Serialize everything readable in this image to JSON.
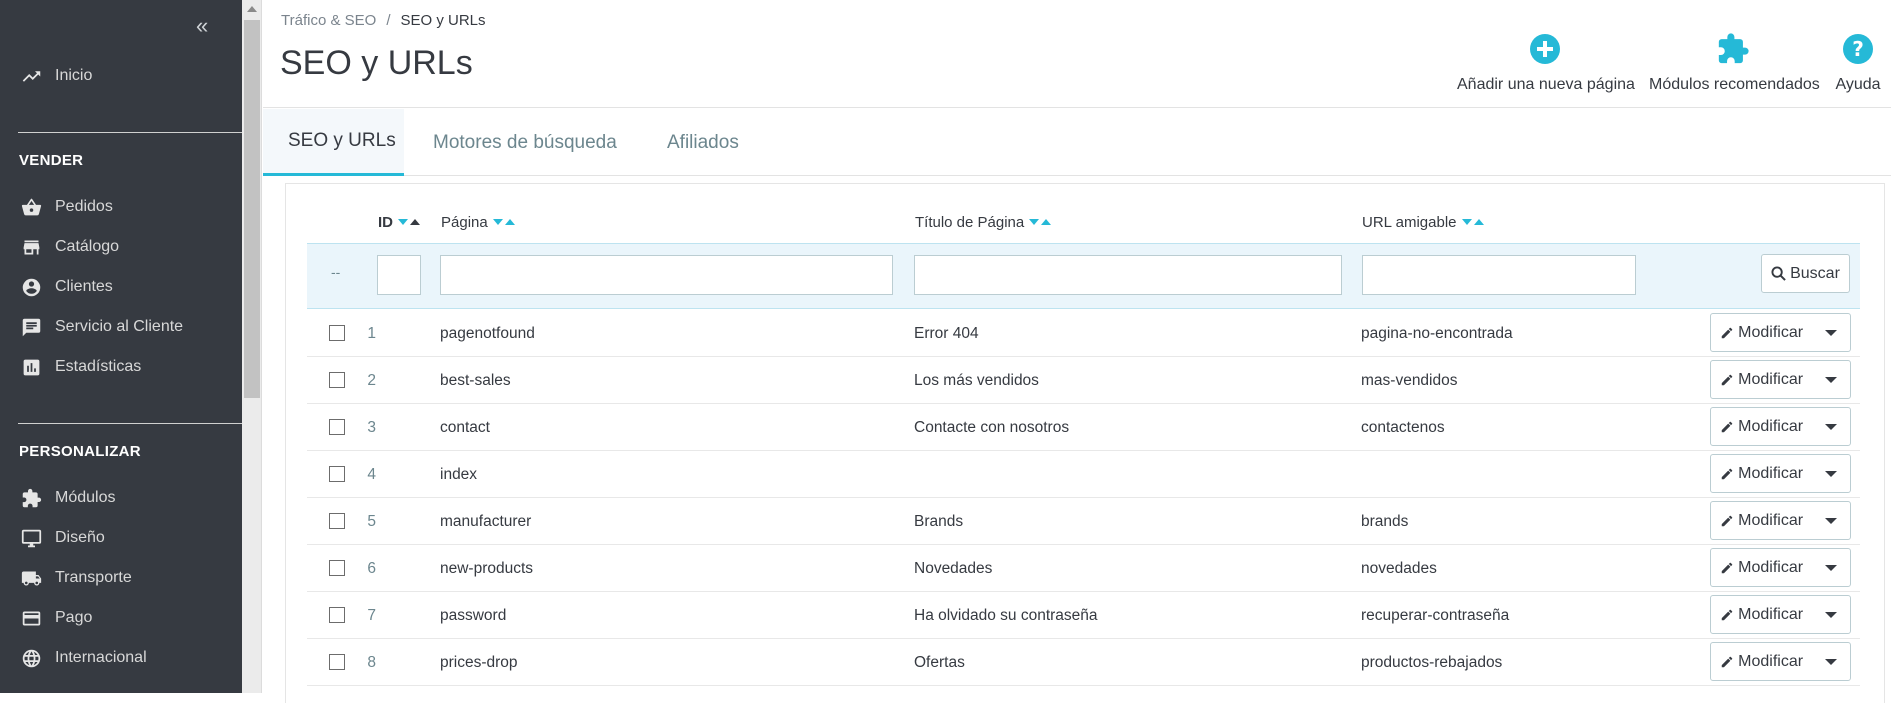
{
  "sidebar": {
    "collapse_glyph": "«",
    "items_top": [
      {
        "label": "Inicio",
        "icon": "trending-up-icon"
      }
    ],
    "section_sell": "VENDER",
    "items_sell": [
      {
        "label": "Pedidos",
        "icon": "basket-icon"
      },
      {
        "label": "Catálogo",
        "icon": "store-icon"
      },
      {
        "label": "Clientes",
        "icon": "account-circle-icon"
      },
      {
        "label": "Servicio al Cliente",
        "icon": "chat-icon"
      },
      {
        "label": "Estadísticas",
        "icon": "bar-chart-icon"
      }
    ],
    "section_customize": "PERSONALIZAR",
    "items_customize": [
      {
        "label": "Módulos",
        "icon": "puzzle-icon"
      },
      {
        "label": "Diseño",
        "icon": "monitor-icon"
      },
      {
        "label": "Transporte",
        "icon": "truck-icon"
      },
      {
        "label": "Pago",
        "icon": "credit-card-icon"
      },
      {
        "label": "Internacional",
        "icon": "globe-icon"
      }
    ]
  },
  "header": {
    "breadcrumb": [
      "Tráfico & SEO",
      "SEO y URLs"
    ],
    "breadcrumb_separator": "/",
    "title": "SEO y URLs",
    "toolbar": [
      {
        "label": "Añadir una nueva página",
        "icon": "plus-circle-icon"
      },
      {
        "label": "Módulos recomendados",
        "icon": "puzzle-icon"
      },
      {
        "label": "Ayuda",
        "icon": "help-circle-icon"
      }
    ]
  },
  "tabs": [
    "SEO y URLs",
    "Motores de búsqueda",
    "Afiliados"
  ],
  "colors": {
    "accent": "#25b9d7",
    "sidebar_bg": "#363a41",
    "filter_bg": "#eaf5fb"
  },
  "table": {
    "columns": [
      "ID",
      "Página",
      "Título de Página",
      "URL amigable"
    ],
    "filter_dash": "--",
    "search_label": "Buscar",
    "edit_label": "Modificar",
    "rows": [
      {
        "id": "1",
        "page": "pagenotfound",
        "title": "Error 404",
        "url": "pagina-no-encontrada"
      },
      {
        "id": "2",
        "page": "best-sales",
        "title": "Los más vendidos",
        "url": "mas-vendidos"
      },
      {
        "id": "3",
        "page": "contact",
        "title": "Contacte con nosotros",
        "url": "contactenos"
      },
      {
        "id": "4",
        "page": "index",
        "title": "",
        "url": ""
      },
      {
        "id": "5",
        "page": "manufacturer",
        "title": "Brands",
        "url": "brands"
      },
      {
        "id": "6",
        "page": "new-products",
        "title": "Novedades",
        "url": "novedades"
      },
      {
        "id": "7",
        "page": "password",
        "title": "Ha olvidado su contraseña",
        "url": "recuperar-contraseña"
      },
      {
        "id": "8",
        "page": "prices-drop",
        "title": "Ofertas",
        "url": "productos-rebajados"
      }
    ]
  }
}
